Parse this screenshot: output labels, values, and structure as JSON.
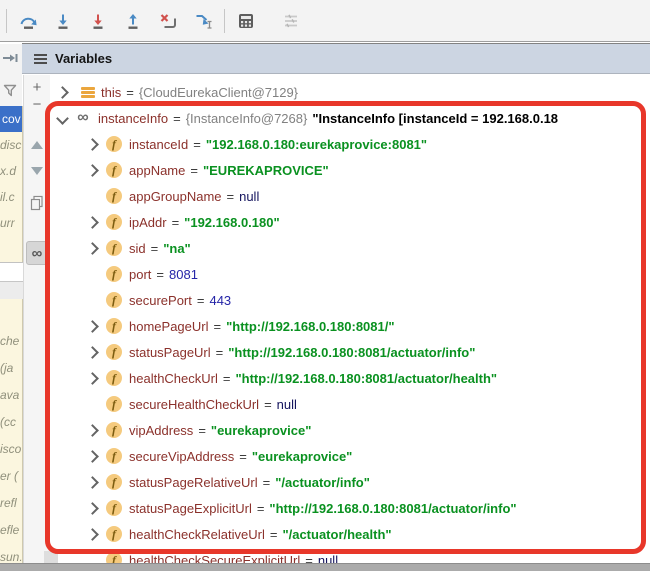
{
  "toolbar": {
    "buttons": [
      "step-over",
      "step-into",
      "force-step-into",
      "step-out",
      "drop-frame",
      "run-to-cursor",
      "evaluate-expression",
      "filter-arrangement-disabled"
    ]
  },
  "header": {
    "title": "Variables"
  },
  "left_rail": {
    "icons": [
      "show-execution-point",
      "filter-funnel"
    ]
  },
  "watch_rail": {
    "icons": [
      "add-watch",
      "remove-watch",
      "move-watch-up",
      "move-watch-down",
      "duplicate-watch",
      "show-watches-toggle"
    ],
    "add_glyph": "+",
    "remove_glyph": "−",
    "show_watches_glyph": "∞"
  },
  "frames_sidebar": {
    "selected_fragment": "cov",
    "fragments_top": [
      "disc",
      "x.d",
      "il.c",
      "urr"
    ],
    "fragments_bottom": [
      "che",
      "(ja",
      "ava",
      "(cc",
      "isco",
      "er (",
      "refl",
      "efle",
      "sun."
    ]
  },
  "debug_tree": {
    "equals": "=",
    "field_icon_glyph": "f",
    "watch_icon_glyph": "∞",
    "this_row": {
      "name": "this",
      "ref": "{CloudEurekaClient@7129}"
    },
    "instance_row": {
      "name": "instanceInfo",
      "ref": "{InstanceInfo@7268}",
      "preview": "\"InstanceInfo [instanceId = 192.168.0.18"
    },
    "fields": [
      {
        "name": "instanceId",
        "value": "\"192.168.0.180:eurekaprovice:8081\"",
        "type": "string",
        "expandable": true
      },
      {
        "name": "appName",
        "value": "\"EUREKAPROVICE\"",
        "type": "string",
        "expandable": true
      },
      {
        "name": "appGroupName",
        "value": "null",
        "type": "keyword",
        "expandable": false
      },
      {
        "name": "ipAddr",
        "value": "\"192.168.0.180\"",
        "type": "string",
        "expandable": true
      },
      {
        "name": "sid",
        "value": "\"na\"",
        "type": "string",
        "expandable": true
      },
      {
        "name": "port",
        "value": "8081",
        "type": "number",
        "expandable": false
      },
      {
        "name": "securePort",
        "value": "443",
        "type": "number",
        "expandable": false
      },
      {
        "name": "homePageUrl",
        "value": "\"http://192.168.0.180:8081/\"",
        "type": "string",
        "expandable": true
      },
      {
        "name": "statusPageUrl",
        "value": "\"http://192.168.0.180:8081/actuator/info\"",
        "type": "string",
        "expandable": true
      },
      {
        "name": "healthCheckUrl",
        "value": "\"http://192.168.0.180:8081/actuator/health\"",
        "type": "string",
        "expandable": true
      },
      {
        "name": "secureHealthCheckUrl",
        "value": "null",
        "type": "keyword",
        "expandable": false
      },
      {
        "name": "vipAddress",
        "value": "\"eurekaprovice\"",
        "type": "string",
        "expandable": true
      },
      {
        "name": "secureVipAddress",
        "value": "\"eurekaprovice\"",
        "type": "string",
        "expandable": true
      },
      {
        "name": "statusPageRelativeUrl",
        "value": "\"/actuator/info\"",
        "type": "string",
        "expandable": true
      },
      {
        "name": "statusPageExplicitUrl",
        "value": "\"http://192.168.0.180:8081/actuator/info\"",
        "type": "string",
        "expandable": true
      },
      {
        "name": "healthCheckRelativeUrl",
        "value": "\"/actuator/health\"",
        "type": "string",
        "expandable": true
      },
      {
        "name": "healthCheckSecureExplicitUrl",
        "value": "null",
        "type": "keyword",
        "expandable": false
      }
    ]
  },
  "colors": {
    "annotation_red": "#e8372a",
    "header_bg": "#ccd5e2",
    "string_value": "#0a9120",
    "variable_name": "#8b312b",
    "selected_frame_bg": "#3b70c8"
  }
}
